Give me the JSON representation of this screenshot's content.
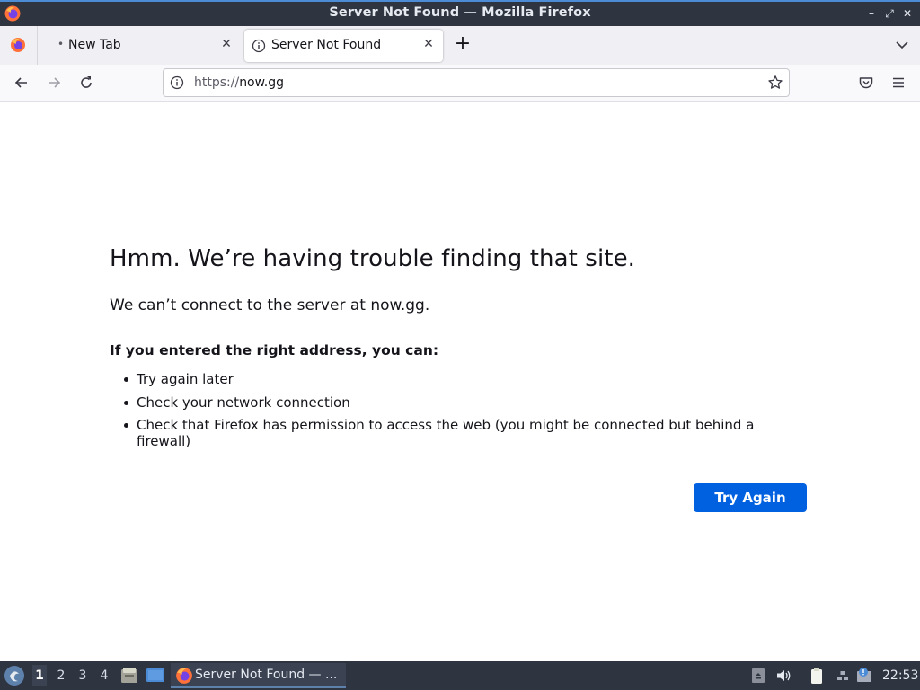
{
  "window": {
    "title": "Server Not Found — Mozilla Firefox"
  },
  "tabs": [
    {
      "label": "New Tab",
      "active": false
    },
    {
      "label": "Server Not Found",
      "active": true
    }
  ],
  "urlbar": {
    "scheme": "https://",
    "host": "now.gg"
  },
  "error": {
    "title": "Hmm. We’re having trouble finding that site.",
    "description": "We can’t connect to the server at now.gg.",
    "subtitle": "If you entered the right address, you can:",
    "suggestions": [
      "Try again later",
      "Check your network connection",
      "Check that Firefox has permission to access the web (you might be connected but behind a firewall)"
    ],
    "button_label": "Try Again"
  },
  "taskbar": {
    "workspaces": [
      "1",
      "2",
      "3",
      "4"
    ],
    "active_workspace": "1",
    "task_label": "Server Not Found — ...",
    "clock": "22:53"
  },
  "colors": {
    "accent": "#0061e0",
    "titlebar": "#2e3440",
    "taskbar": "#2e3440"
  },
  "icons": [
    "firefox-icon",
    "back-icon",
    "forward-icon",
    "reload-icon",
    "info-icon",
    "star-icon",
    "pocket-icon",
    "hamburger-menu-icon",
    "tab-close-icon",
    "new-tab-icon",
    "tab-list-icon"
  ]
}
